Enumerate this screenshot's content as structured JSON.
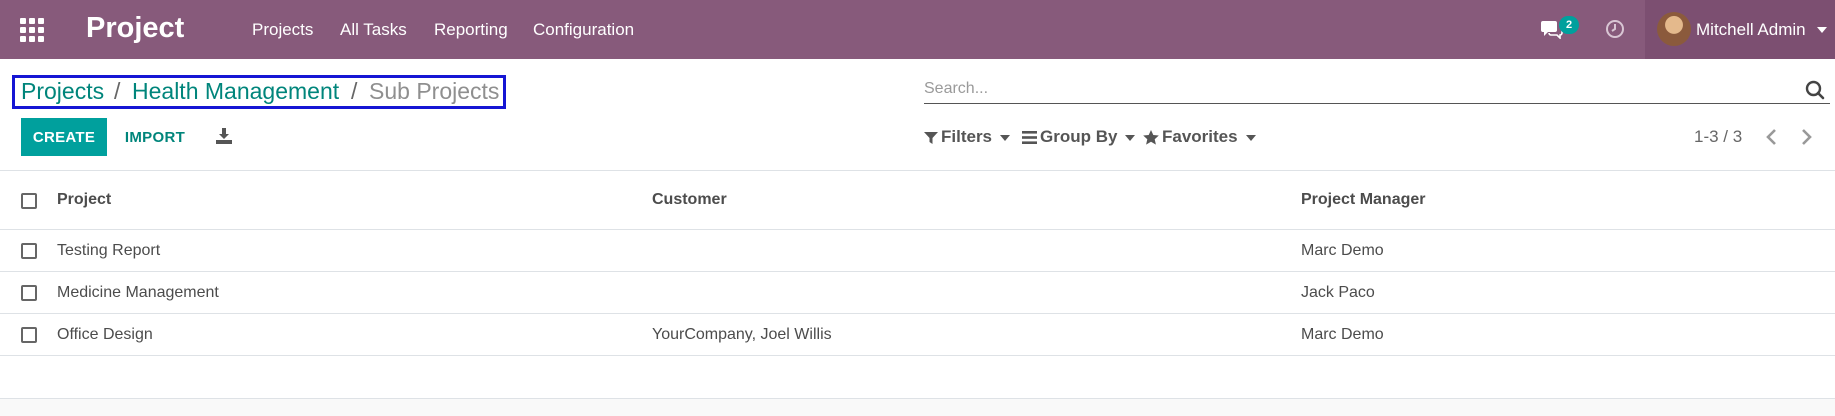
{
  "navbar": {
    "brand": "Project",
    "menu": [
      "Projects",
      "All Tasks",
      "Reporting",
      "Configuration"
    ],
    "chat_count": "2",
    "user_name": "Mitchell Admin",
    "icons": {
      "apps": "apps-grid-icon",
      "chat": "chat-icon",
      "activity": "clock-icon"
    }
  },
  "breadcrumb": {
    "items": [
      "Projects",
      "Health Management"
    ],
    "separator": "/",
    "active": "Sub Projects"
  },
  "search": {
    "placeholder": "Search..."
  },
  "toolbar": {
    "create_label": "CREATE",
    "import_label": "IMPORT"
  },
  "filters": {
    "filters_label": "Filters",
    "group_by_label": "Group By",
    "favorites_label": "Favorites"
  },
  "pager": {
    "value": "1-3 / 3"
  },
  "table": {
    "columns": [
      "Project",
      "Customer",
      "Project Manager"
    ],
    "rows": [
      {
        "project": "Testing Report",
        "customer": "",
        "manager": "Marc Demo"
      },
      {
        "project": "Medicine Management",
        "customer": "",
        "manager": "Jack Paco"
      },
      {
        "project": "Office Design",
        "customer": "YourCompany, Joel Willis",
        "manager": "Marc Demo"
      }
    ]
  },
  "colors": {
    "navbar": "#875a7b",
    "primary": "#00a09d",
    "link": "#00857b",
    "highlight_box": "#1616d4"
  }
}
